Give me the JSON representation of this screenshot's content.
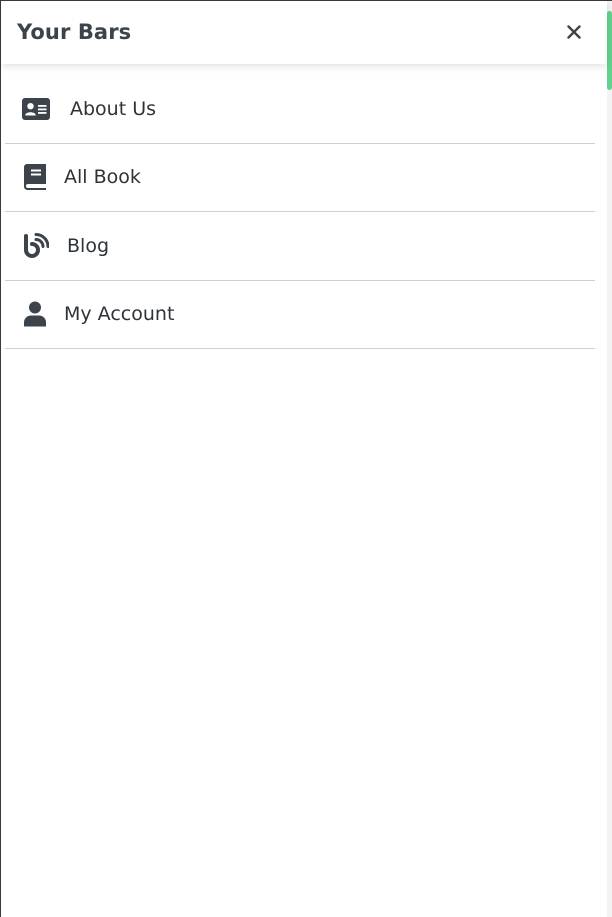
{
  "header": {
    "title": "Your Bars",
    "close_icon": "close-icon"
  },
  "menu": {
    "items": [
      {
        "label": "About Us",
        "icon": "id-card-icon"
      },
      {
        "label": "All Book",
        "icon": "book-icon"
      },
      {
        "label": "Blog",
        "icon": "blog-icon"
      },
      {
        "label": "My Account",
        "icon": "user-icon"
      }
    ]
  },
  "colors": {
    "text": "#2e3338",
    "icon": "#3d434a",
    "divider": "#cfcfcf",
    "scroll_thumb": "#62d38f"
  }
}
